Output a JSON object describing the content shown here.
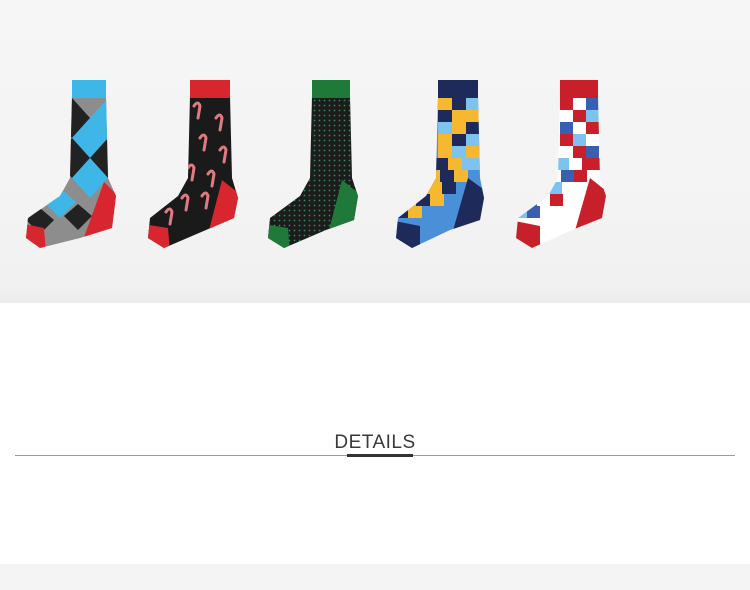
{
  "product_photo": {
    "socks": [
      {
        "name": "argyle",
        "cuff_color": "#3fb6e8",
        "heel_toe_color": "#d7262e",
        "body_color": "#8d8d8d",
        "pattern_colors": [
          "#222222",
          "#3fb6e8"
        ]
      },
      {
        "name": "candy-cane",
        "cuff_color": "#d7262e",
        "heel_toe_color": "#d7262e",
        "body_color": "#1a1a1a",
        "pattern_colors": [
          "#e07a82",
          "#ffffff"
        ]
      },
      {
        "name": "dotted-green",
        "cuff_color": "#1f7a3a",
        "heel_toe_color": "#1f7a3a",
        "body_color": "#1c1c1c",
        "pattern_colors": [
          "#2e8b57"
        ]
      },
      {
        "name": "puzzle-yellow",
        "cuff_color": "#1e2a5a",
        "heel_toe_color": "#1e2a5a",
        "body_color": "#4a90d9",
        "pattern_colors": [
          "#f5b82e",
          "#1e2a5a",
          "#7ec3f0"
        ]
      },
      {
        "name": "puzzle-red",
        "cuff_color": "#c8202a",
        "heel_toe_color": "#c8202a",
        "body_color": "#ffffff",
        "pattern_colors": [
          "#c8202a",
          "#3b5fb0",
          "#7ec3f0"
        ]
      }
    ]
  },
  "details": {
    "heading": "DETAILS"
  }
}
